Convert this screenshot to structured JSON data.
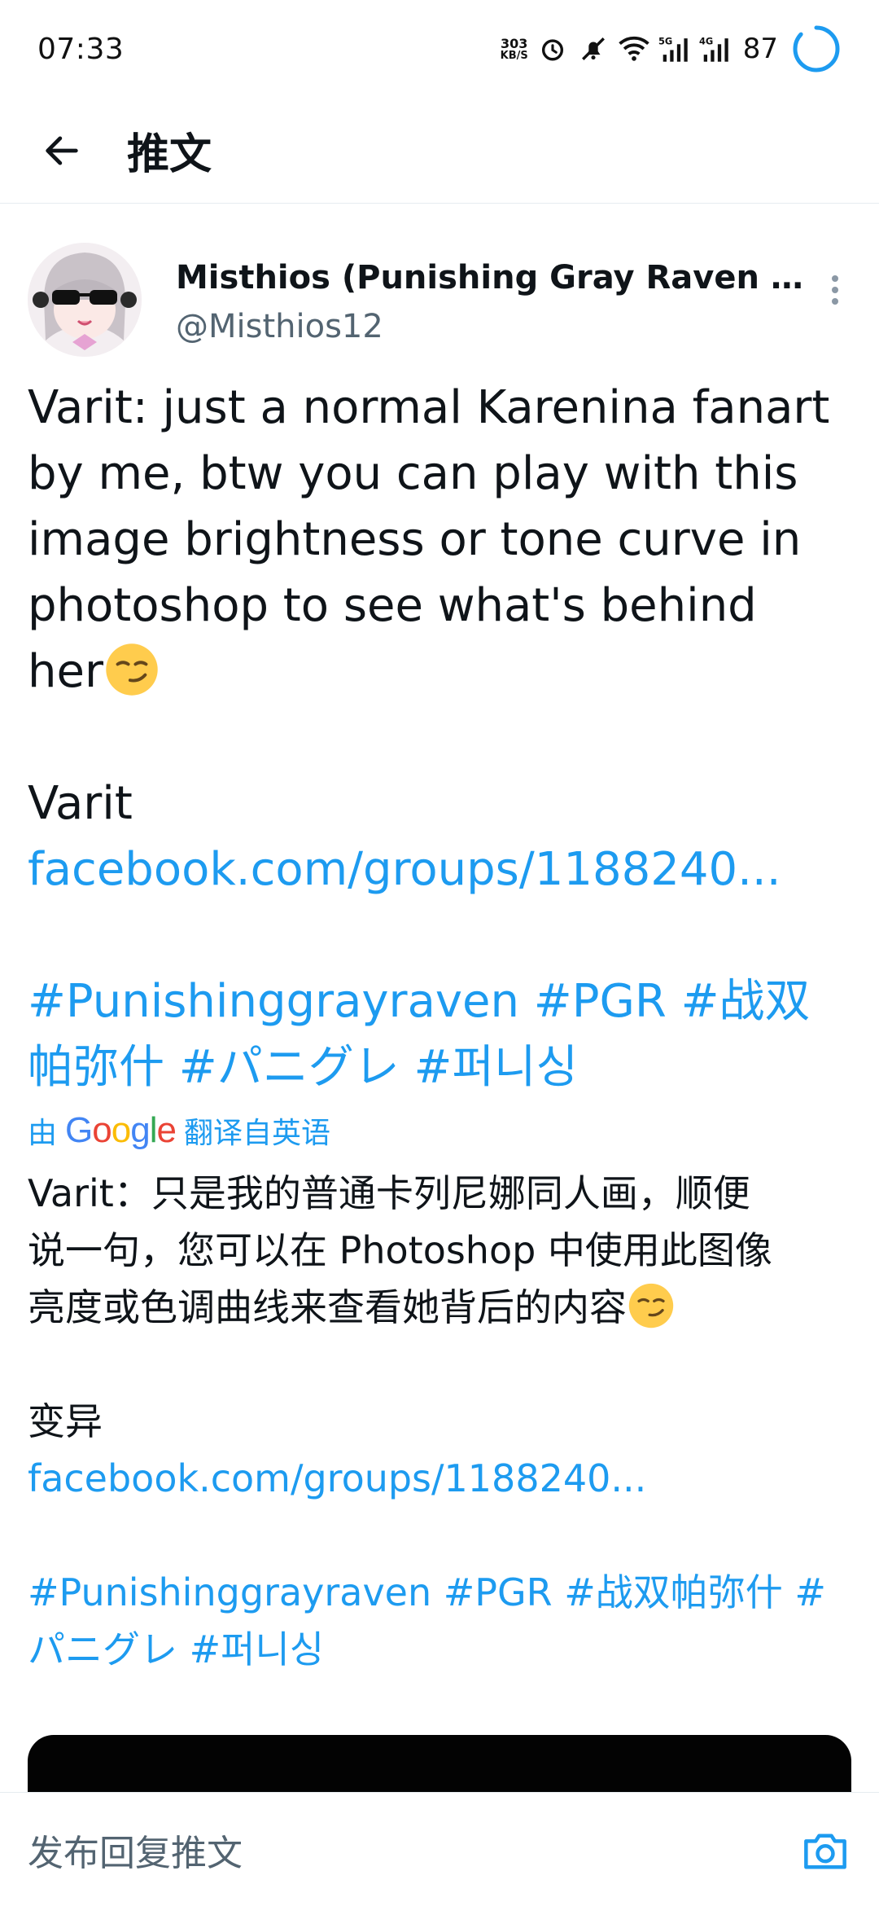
{
  "status_bar": {
    "time": "07:33",
    "net_speed_value": "303",
    "net_speed_unit": "KB/S",
    "signal_1_label": "5G",
    "signal_2_label": "4G",
    "battery": "87"
  },
  "header": {
    "title": "推文"
  },
  "tweet": {
    "display_name": "Misthios (Punishing Gray Raven PG...",
    "handle": "@Misthios12",
    "text_lines": [
      "Varit: just a normal Karenina fanart",
      "by me, btw you can play with this",
      "image brightness or tone curve in",
      "photoshop to see what's behind",
      "her"
    ],
    "credit": "Varit",
    "link": "facebook.com/groups/1188240...",
    "hashtags_line1": "#Punishinggrayraven #PGR #战双",
    "hashtags_line2": "帕弥什 #パニグレ #퍼니싱",
    "translated_prefix": "由",
    "translated_suffix": "翻译自英语",
    "google_logo": "Google",
    "translation_lines": [
      "Varit：只是我的普通卡列尼娜同人画，顺便",
      "说一句，您可以在 Photoshop 中使用此图像",
      "亮度或色调曲线来查看她背后的内容"
    ],
    "translation_credit": "变异",
    "translation_link": "facebook.com/groups/1188240...",
    "translation_hashtags_line1": "#Punishinggrayraven #PGR #战双帕弥什 #",
    "translation_hashtags_line2": "パニグレ #퍼니싱"
  },
  "reply_bar": {
    "placeholder": "发布回复推文"
  },
  "colors": {
    "link": "#1d9bf0",
    "text": "#0f1419",
    "secondary": "#536471",
    "battery_ring": "#1d9bf0"
  },
  "icons": {
    "back": "arrow-left-icon",
    "more": "vertical-dots-icon",
    "camera": "camera-icon",
    "alarm": "alarm-icon",
    "mute": "bell-off-icon",
    "wifi": "wifi-icon",
    "emoji": "smirking-face-emoji"
  }
}
